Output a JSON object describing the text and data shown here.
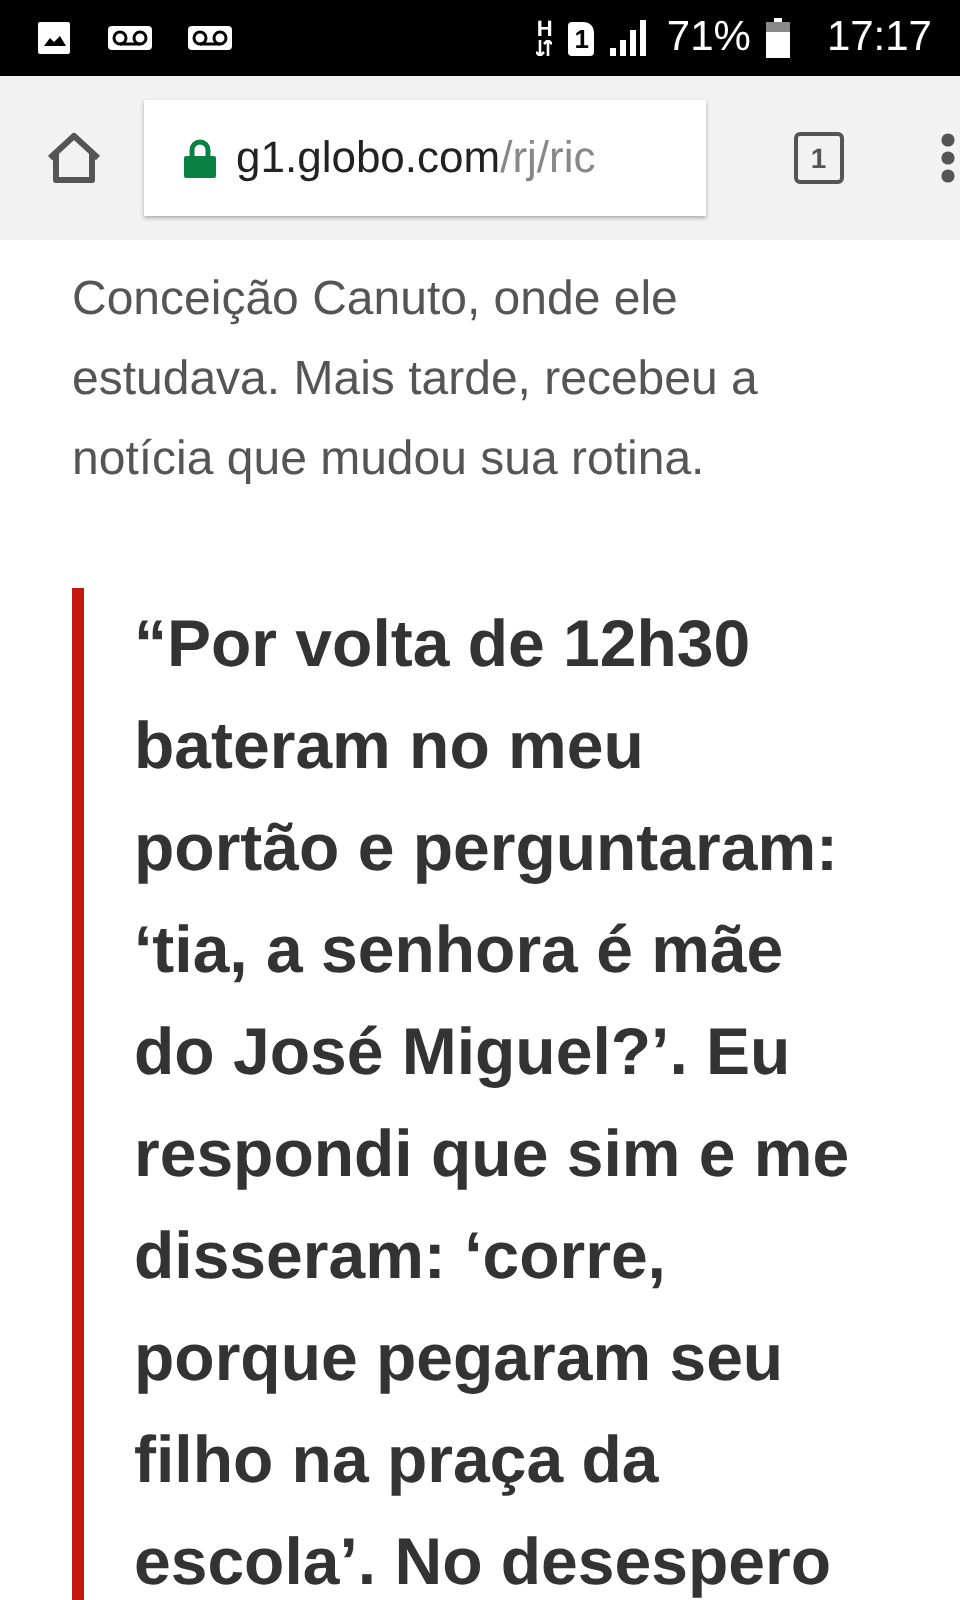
{
  "status_bar": {
    "network_type": "H",
    "sim_slot": "1",
    "battery": "71%",
    "time": "17:17"
  },
  "browser": {
    "url_host": "g1.globo.com",
    "url_path": "/rj/ric",
    "secure": true,
    "tab_count": "1"
  },
  "article": {
    "paragraph": "Conceição Canuto, onde ele\nestudava. Mais tarde, recebeu a\nnotícia que mudou sua rotina.",
    "quote": "“Por volta de 12h30\nbateram no meu\nportão e perguntaram:\n‘tia, a senhora é mãe\ndo José Miguel?’. Eu\nrespondi que sim e me\ndisseram: ‘corre,\nporque pegaram seu\nfilho na praça da\nescola’. No desespero"
  }
}
